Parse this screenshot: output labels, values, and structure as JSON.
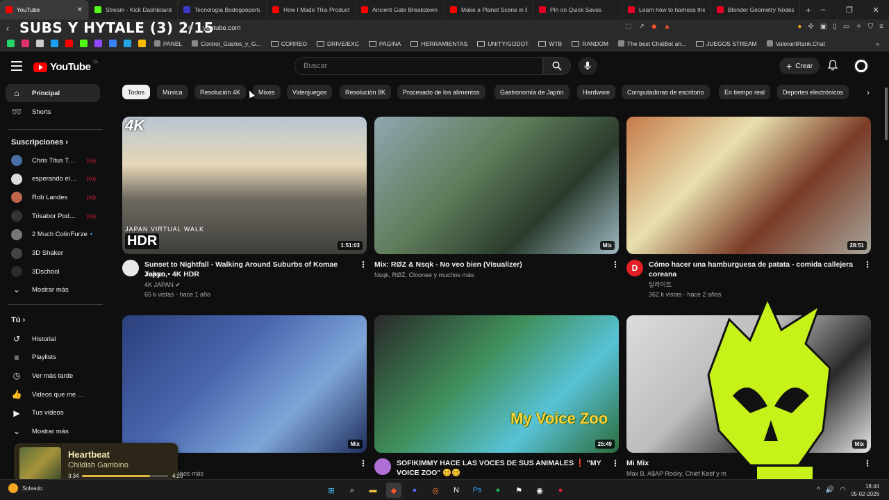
{
  "browser": {
    "tabs": [
      {
        "label": "YouTube",
        "color": "#ff0000",
        "active": true
      },
      {
        "label": "Stream - Kick Dashboard",
        "color": "#53fc18"
      },
      {
        "label": "Tecnología Bodegaoportunidad",
        "color": "#3a3acb"
      },
      {
        "label": "How I Made This Product",
        "color": "#ff0000"
      },
      {
        "label": "Ancient Gate Breakdown |",
        "color": "#ff0000"
      },
      {
        "label": "Make a Planet Scene in Blender",
        "color": "#ff0000"
      },
      {
        "label": "Pin on Quick Saves",
        "color": "#e60023"
      },
      {
        "label": "Learn how to harness the",
        "color": "#e60023"
      },
      {
        "label": "Blender Geometry Nodes",
        "color": "#e60023"
      }
    ],
    "new_tab": "+",
    "overlay_title": "SUBS Y HYTALE (3) 2/15",
    "url": "youtube.com",
    "bookmarks": [
      {
        "label": "PANEL",
        "type": "link"
      },
      {
        "label": "Control_Gastos_y_G...",
        "type": "link"
      },
      {
        "label": "CORREO",
        "type": "folder"
      },
      {
        "label": "DRIVE/EXC",
        "type": "folder"
      },
      {
        "label": "PAGINA",
        "type": "folder"
      },
      {
        "label": "HERRAMIENTAS",
        "type": "folder"
      },
      {
        "label": "UNITY/GODOT",
        "type": "folder"
      },
      {
        "label": "WTB",
        "type": "folder"
      },
      {
        "label": "RANDOM",
        "type": "folder"
      },
      {
        "label": "The best ChatBot an...",
        "type": "link"
      },
      {
        "label": "JUEGOS STREAM",
        "type": "folder"
      },
      {
        "label": "ValorantRank.Chat",
        "type": "link"
      }
    ],
    "bookmark_favicons": [
      "#25d366",
      "#e1306c",
      "#cccccc",
      "#1da1f2",
      "#ff0000",
      "#53fc18",
      "#9146ff",
      "#3b82f6",
      "#26a5e4",
      "#fbbc04"
    ]
  },
  "youtube": {
    "logo_text": "YouTube",
    "country": "CL",
    "search_placeholder": "Buscar",
    "create_label": "Crear",
    "chips": [
      "Todos",
      "Música",
      "Resolución 4K",
      "Mixes",
      "Videojuegos",
      "Resolución 8K",
      "Procesado de los alimentos",
      "Gastronomía de Japón",
      "Hardware",
      "Computadoras de escritorio",
      "En tiempo real",
      "Deportes electrónicos"
    ],
    "sidebar": {
      "main": [
        {
          "label": "Principal",
          "icon": "home-icon"
        },
        {
          "label": "Shorts",
          "icon": "shorts-icon"
        }
      ],
      "subs_heading": "Suscripciones",
      "subs": [
        {
          "label": "Chris Titus Tech",
          "live": true,
          "color": "#4a6fa5"
        },
        {
          "label": "esperando el ren...",
          "live": true,
          "color": "#dddddd"
        },
        {
          "label": "Rob Landes",
          "live": true,
          "color": "#c0664a"
        },
        {
          "label": "Trisabor Podcast",
          "live": true,
          "color": "#333333"
        },
        {
          "label": "2 Much ColinFurze",
          "live": false,
          "dot": true,
          "color": "#777777"
        },
        {
          "label": "3D Shaker",
          "live": false,
          "color": "#444444"
        },
        {
          "label": "3Dschool",
          "live": false,
          "color": "#2b2b2b"
        }
      ],
      "show_more": "Mostrar más",
      "you_heading": "Tú",
      "you": [
        {
          "label": "Historial",
          "icon": "history-icon"
        },
        {
          "label": "Playlists",
          "icon": "playlist-icon"
        },
        {
          "label": "Ver más tarde",
          "icon": "clock-icon"
        },
        {
          "label": "Videos que me gus...",
          "icon": "like-icon"
        },
        {
          "label": "Tus videos",
          "icon": "video-icon"
        }
      ],
      "show_more_2": "Mostrar más"
    },
    "videos": [
      {
        "title1": "Sunset to Nightfall - Walking Around Suburbs of Komae Tokyo,",
        "title2": "Japan • 4K HDR",
        "meta1": "4K JAPAN ✔",
        "meta2": "65 k vistas - hace 1 año",
        "badge": "1:51:03",
        "avatar": "#e8e8e8",
        "thumb_overlay_top": "4K",
        "thumb_overlay_bottom": "HDR",
        "thumb_overlay_caption": "JAPAN VIRTUAL WALK"
      },
      {
        "title1": "Mix: RØZ & Nsqk - No veo bien (Visualizer)",
        "title2": "",
        "meta1": "Nsqk, RØZ, Cloonee y muchos más",
        "meta2": "",
        "badge": "Mix",
        "avatar": ""
      },
      {
        "title1": "Cómo hacer una hamburguesa de patata - comida callejera",
        "title2": "coreana",
        "meta1": "딜라이트",
        "meta2": "362 k vistas - hace 2 años",
        "badge": "28:51",
        "avatar": "#e41e26",
        "avatar_letter": "D"
      },
      {
        "title1": "trónica",
        "title2": "",
        "meta1": "Charlie, W&W y muchos más",
        "meta2": "",
        "badge": "Mix",
        "avatar": ""
      },
      {
        "title1": "SOFIKIMMY HACE LAS VOCES DE SUS ANIMALES ❗ \"MY",
        "title2": "VOICE ZOO\" 🥴🥴",
        "meta1": "",
        "meta2": "",
        "badge": "25:49",
        "avatar": "#b06fd6",
        "thumb_overlay_caption": "My Voice Zoo"
      },
      {
        "title1": "Mi Mix",
        "title2": "",
        "meta1": "Max B, A$AP Rocky, Chief Keef y m",
        "meta2": "",
        "badge": "Mix",
        "avatar": ""
      }
    ]
  },
  "now_playing": {
    "title": "Heartbeat",
    "artist": "Childish Gambino",
    "current": "3:34",
    "total": "4:29",
    "progress": 0.79,
    "art_caption": "CHILDISH GAMBINO"
  },
  "taskbar": {
    "weather": "Soleado",
    "time": "18:44",
    "date": "05-02-2026",
    "tray_label": "ESP"
  }
}
